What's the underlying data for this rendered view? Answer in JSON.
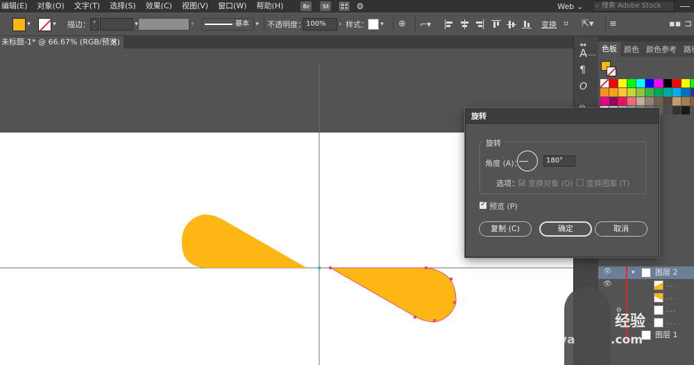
{
  "menubar": {
    "items": [
      "编辑(E)",
      "对象(O)",
      "文字(T)",
      "选择(S)",
      "效果(C)",
      "视图(V)",
      "窗口(W)",
      "帮助(H)"
    ],
    "bridge_label": "Br",
    "stock_label": "St",
    "workspace": "Web",
    "search_placeholder": "搜索 Adobe Stock"
  },
  "controlbar": {
    "fill_color": "#fdb714",
    "stroke_label": "描边：",
    "stroke_style": "基本",
    "opacity_label": "不透明度：",
    "opacity_value": "100%",
    "style_label": "样式：",
    "transform_label": "变换"
  },
  "document": {
    "tab_title": "未标题-1* @ 66.67% (RGB/预览)",
    "close_glyph": "✕"
  },
  "tool_strip": {
    "icons": [
      "A",
      "¶",
      "O"
    ]
  },
  "right_panel": {
    "tabs": [
      "色板",
      "颜色",
      "颜色参考",
      "路径查"
    ],
    "swatch_rows": [
      [
        "#ffffff",
        "#ff0000",
        "#ffff00",
        "#00ff00",
        "#00ffff",
        "#0000ff",
        "#ff00ff",
        "#000000",
        "#ff0000",
        "#ffff00",
        "#00ff00",
        "#00ffff",
        "#0000ff",
        "#ff00ff"
      ],
      [
        "#f7941d",
        "#f9a11b",
        "#fdc82f",
        "#c5d92d",
        "#8dc63f",
        "#39b54a",
        "#00a651",
        "#00a99d",
        "#00aeef",
        "#0072bc",
        "#2e3192",
        "#92278f"
      ],
      [
        "#ec008c",
        "#9e005d",
        "#ed145b",
        "#f26d7d",
        "#c7b299",
        "#998675",
        "#736357",
        "#534741",
        "#c69c6d",
        "#a67c52",
        "#8c6239",
        "#754c24"
      ],
      [
        "#ffffff",
        "#e6e6e6",
        "#cccccc",
        "#b3b3b3",
        "#999999",
        "#808080",
        "#666666",
        "#4d4d4d",
        "#333333",
        "#1a1a1a"
      ]
    ]
  },
  "layers": {
    "layer2": "图层 2",
    "sub": ". . .",
    "layer1": "图层 1"
  },
  "dialog": {
    "title": "旋转",
    "group_title": "旋转",
    "angle_label": "角度 (A)：",
    "angle_value": "180°",
    "options_label": "选项：",
    "transform_objects": "变换对象 (O)",
    "transform_patterns": "变换图案 (T)",
    "preview_label": "预览 (P)",
    "copy_label": "复制 (C)",
    "ok_label": "确定",
    "cancel_label": "取消"
  },
  "watermark": {
    "text": "经验",
    "text2": ".com",
    "text3": "ya"
  },
  "colors": {
    "shape_fill": "#fdb714",
    "selection": "#e84a73",
    "guide": "#6f6f6f"
  }
}
